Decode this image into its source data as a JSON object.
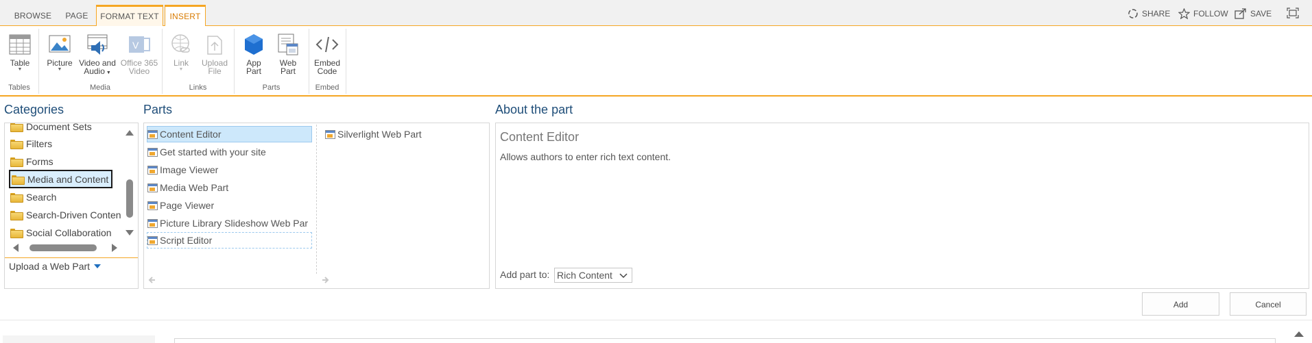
{
  "tabs": [
    {
      "label": "BROWSE"
    },
    {
      "label": "PAGE"
    },
    {
      "label": "FORMAT TEXT"
    },
    {
      "label": "INSERT"
    }
  ],
  "top_actions": {
    "share": "SHARE",
    "follow": "FOLLOW",
    "save": "SAVE"
  },
  "ribbon": {
    "table": {
      "label": "Table"
    },
    "picture": {
      "label": "Picture"
    },
    "video": {
      "line1": "Video and",
      "line2": "Audio"
    },
    "office365": {
      "line1": "Office 365",
      "line2": "Video"
    },
    "link": {
      "label": "Link"
    },
    "upload": {
      "line1": "Upload",
      "line2": "File"
    },
    "apppart": {
      "line1": "App",
      "line2": "Part"
    },
    "webpart": {
      "line1": "Web",
      "line2": "Part"
    },
    "embed": {
      "line1": "Embed",
      "line2": "Code"
    },
    "groups": {
      "tables": "Tables",
      "media": "Media",
      "links": "Links",
      "parts": "Parts",
      "embed": "Embed"
    }
  },
  "categories": {
    "title": "Categories",
    "items": [
      {
        "label": "Document Sets"
      },
      {
        "label": "Filters"
      },
      {
        "label": "Forms"
      },
      {
        "label": "Media and Content"
      },
      {
        "label": "Search"
      },
      {
        "label": "Search-Driven Conten"
      },
      {
        "label": "Social Collaboration"
      }
    ],
    "upload_link": "Upload a Web Part"
  },
  "parts": {
    "title": "Parts",
    "column1": [
      {
        "label": "Content Editor"
      },
      {
        "label": "Get started with your site"
      },
      {
        "label": "Image Viewer"
      },
      {
        "label": "Media Web Part"
      },
      {
        "label": "Page Viewer"
      },
      {
        "label": "Picture Library Slideshow Web Par"
      },
      {
        "label": "Script Editor"
      }
    ],
    "column2": [
      {
        "label": "Silverlight Web Part"
      }
    ]
  },
  "about": {
    "title": "About the part",
    "part_name": "Content Editor",
    "description": "Allows authors to enter rich text content.",
    "add_part_to_label": "Add part to:",
    "add_part_to_value": "Rich Content"
  },
  "buttons": {
    "add": "Add",
    "cancel": "Cancel"
  },
  "colors": {
    "accent": "#f5a623",
    "title_blue": "#1f4e79",
    "selection": "#cde8fb"
  }
}
